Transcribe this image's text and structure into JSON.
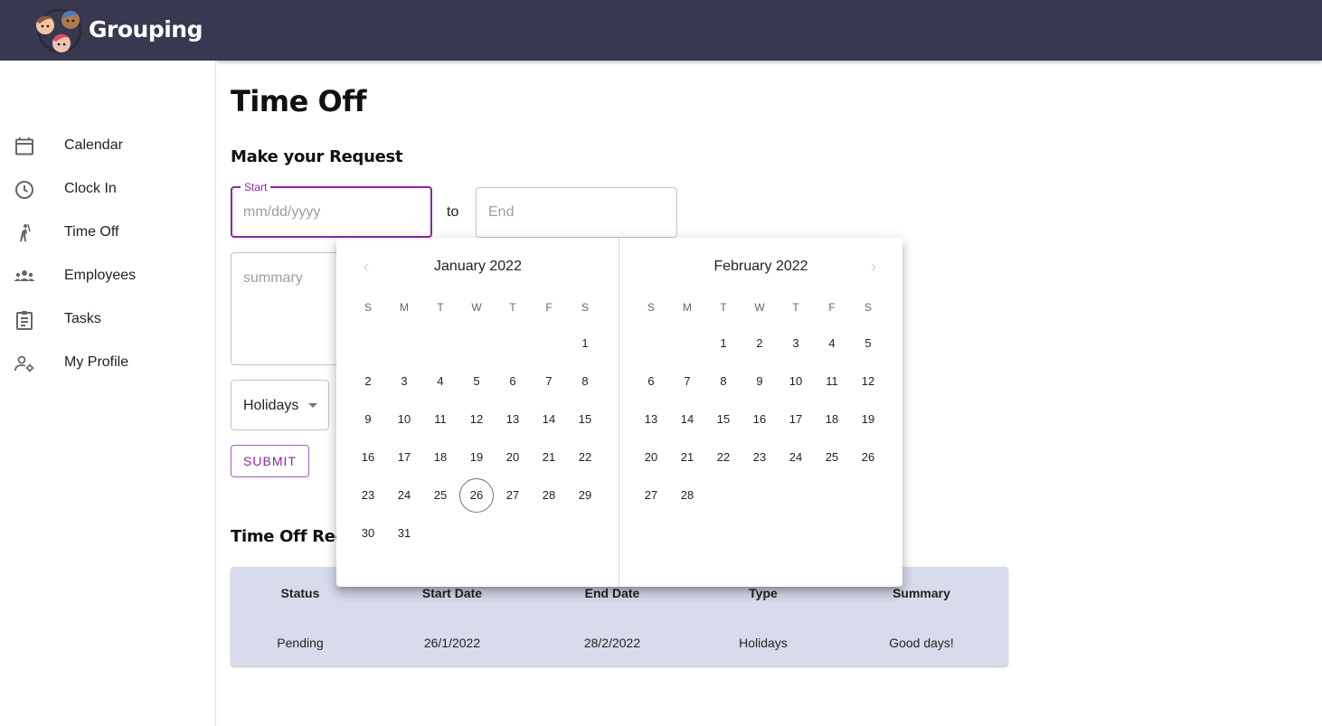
{
  "app": {
    "name": "Grouping"
  },
  "sidebar": {
    "items": [
      {
        "label": "Calendar",
        "icon": "calendar-icon"
      },
      {
        "label": "Clock In",
        "icon": "clock-icon"
      },
      {
        "label": "Time Off",
        "icon": "person-vacation-icon"
      },
      {
        "label": "Employees",
        "icon": "people-icon"
      },
      {
        "label": "Tasks",
        "icon": "clipboard-icon"
      },
      {
        "label": "My Profile",
        "icon": "user-settings-icon"
      }
    ]
  },
  "main": {
    "title": "Time Off",
    "request_section_title": "Make your Request",
    "start_field": {
      "label": "Start",
      "placeholder": "mm/dd/yyyy"
    },
    "to_label": "to",
    "end_field": {
      "placeholder": "End"
    },
    "summary_field": {
      "placeholder": "summary"
    },
    "type_select": {
      "value": "Holidays"
    },
    "submit_label": "SUBMIT",
    "records_section_title": "Time Off Rec"
  },
  "table": {
    "headers": [
      "Status",
      "Start Date",
      "End Date",
      "Type",
      "Summary"
    ],
    "rows": [
      [
        "Pending",
        "26/1/2022",
        "28/2/2022",
        "Holidays",
        "Good days!"
      ]
    ]
  },
  "datepicker": {
    "weekday_labels": [
      "S",
      "M",
      "T",
      "W",
      "T",
      "F",
      "S"
    ],
    "months": [
      {
        "title": "January 2022",
        "first_weekday": 6,
        "days": 31,
        "highlighted_day": 26
      },
      {
        "title": "February 2022",
        "first_weekday": 2,
        "days": 28
      }
    ],
    "prev_arrow": "‹",
    "next_arrow": "›"
  },
  "colors": {
    "header_bg": "#383850",
    "accent": "#8e24aa",
    "table_bg": "#d7dbec"
  }
}
